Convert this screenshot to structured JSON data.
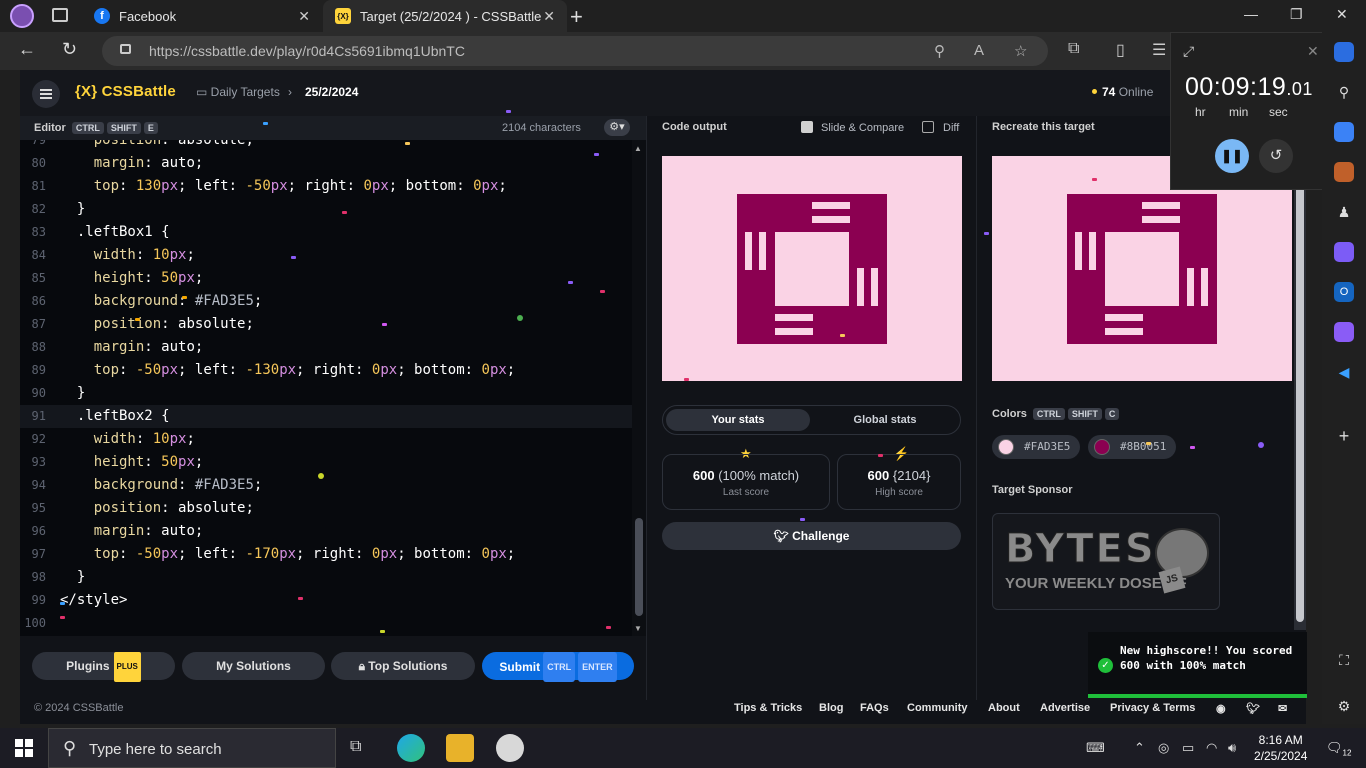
{
  "browser": {
    "tabs": [
      {
        "title": "Facebook",
        "favicon": "facebook-icon"
      },
      {
        "title": "Target (25/2/2024 ) - CSSBattle",
        "favicon": "cssbattle-icon",
        "active": true
      }
    ],
    "url": "https://cssbattle.dev/play/r0d4Cs5691ibmq1UbnTC"
  },
  "app": {
    "brand": "{X} CSSBattle",
    "breadcrumb": [
      "Daily Targets",
      "25/2/2024"
    ],
    "online_count": "74",
    "online_label": "Online"
  },
  "editor": {
    "title": "Editor",
    "shortcut": [
      "CTRL",
      "SHIFT",
      "E"
    ],
    "char_count": "2104 characters",
    "lines": [
      {
        "n": "79",
        "text": "    position: absolute;"
      },
      {
        "n": "80",
        "text": "    margin: auto;"
      },
      {
        "n": "81",
        "text": "    top: 130px; left: -50px; right: 0px; bottom: 0px;"
      },
      {
        "n": "82",
        "text": "  }"
      },
      {
        "n": "83",
        "text": "  .leftBox1 {"
      },
      {
        "n": "84",
        "text": "    width: 10px;"
      },
      {
        "n": "85",
        "text": "    height: 50px;"
      },
      {
        "n": "86",
        "text": "    background: #FAD3E5;"
      },
      {
        "n": "87",
        "text": "    position: absolute;"
      },
      {
        "n": "88",
        "text": "    margin: auto;"
      },
      {
        "n": "89",
        "text": "    top: -50px; left: -130px; right: 0px; bottom: 0px;"
      },
      {
        "n": "90",
        "text": "  }"
      },
      {
        "n": "91",
        "text": "  .leftBox2 {"
      },
      {
        "n": "92",
        "text": "    width: 10px;"
      },
      {
        "n": "93",
        "text": "    height: 50px;"
      },
      {
        "n": "94",
        "text": "    background: #FAD3E5;"
      },
      {
        "n": "95",
        "text": "    position: absolute;"
      },
      {
        "n": "96",
        "text": "    margin: auto;"
      },
      {
        "n": "97",
        "text": "    top: -50px; left: -170px; right: 0px; bottom: 0px;"
      },
      {
        "n": "98",
        "text": "  }"
      },
      {
        "n": "99",
        "text": "</style>"
      },
      {
        "n": "100",
        "text": ""
      }
    ],
    "buttons": {
      "plugins": "Plugins",
      "plugins_tag": "PLUS",
      "my_solutions": "My Solutions",
      "top_solutions": "Top Solutions",
      "submit": "Submit",
      "submit_keys": [
        "CTRL",
        "ENTER"
      ]
    }
  },
  "output": {
    "title": "Code output",
    "slide_compare": "Slide & Compare",
    "diff": "Diff",
    "tabs": {
      "your_stats": "Your stats",
      "global_stats": "Global stats"
    },
    "last_score": {
      "value": "600",
      "detail": "(100% match)",
      "label": "Last score"
    },
    "high_score": {
      "value": "600",
      "detail": "{2104}",
      "label": "High score"
    },
    "challenge": "Challenge"
  },
  "target": {
    "title": "Recreate this target",
    "colors_label": "Colors",
    "colors_keys": [
      "CTRL",
      "SHIFT",
      "C"
    ],
    "colors": [
      {
        "hex": "#FAD3E5",
        "swatch": "#FAD3E5"
      },
      {
        "hex": "#8B0051",
        "swatch": "#8B0051"
      }
    ],
    "sponsor_label": "Target Sponsor",
    "sponsor": {
      "title": "BYTES",
      "tagline": "YOUR WEEKLY DOSE OF",
      "badge": "JS"
    }
  },
  "footer": {
    "copyright": "© 2024 CSSBattle",
    "links": [
      "Tips & Tricks",
      "Blog",
      "FAQs",
      "Community",
      "About",
      "Advertise",
      "Privacy & Terms"
    ]
  },
  "timer": {
    "display": "00:09:19",
    "fraction": ".01",
    "units": [
      "hr",
      "min",
      "sec"
    ]
  },
  "toast": {
    "message": "New highscore!! You scored 600 with 100% match"
  },
  "taskbar": {
    "search_placeholder": "Type here to search",
    "time": "8:16 AM",
    "date": "2/25/2024",
    "notification_count": "12"
  },
  "palette": {
    "pink": "#FAD3E5",
    "magenta": "#8B0051",
    "accent": "#FFD43B",
    "submit": "#0A6CE0",
    "toast_green": "#1FBF3A"
  }
}
